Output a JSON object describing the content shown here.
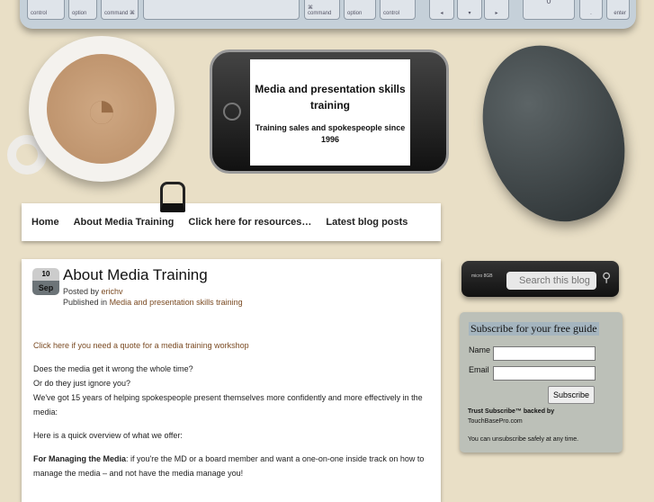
{
  "keyboard": {
    "keys": [
      "control",
      "option",
      "command ⌘",
      "",
      "⌘ command",
      "option",
      "control",
      "◂",
      "▾",
      "▸",
      "0",
      ".",
      "enter"
    ]
  },
  "phone": {
    "title": "Media and presentation skills training",
    "subtitle": "Training sales and spokespeople since 1996"
  },
  "nav": {
    "items": [
      "Home",
      "About Media Training",
      "Click here for resources…",
      "Latest blog posts"
    ]
  },
  "post": {
    "day": "10",
    "month": "Sep",
    "title": "About Media Training",
    "posted_by_label": "Posted by",
    "author": "erichv",
    "published_label": "Published in",
    "category": "Media and presentation skills training",
    "quote_link": "Click here if you need a quote for a media training workshop",
    "p1": [
      "Does the media get it wrong the whole time?",
      "Or do they just ignore you?",
      "We've got 15 years of helping spokespeople present themselves more confidently and more effectively in the media:"
    ],
    "p2": "Here is a quick overview of what we offer:",
    "p3_bold": "For Managing the Media",
    "p3": ": if you're the MD or a board member and want a one-on-one inside track on how to manage the media – and not have the media manage you!"
  },
  "search": {
    "placeholder": "Search this blog",
    "usb_label": "micro 8GB"
  },
  "subscribe": {
    "title": "Subscribe for your free guide",
    "name_label": "Name",
    "email_label": "Email",
    "button": "Subscribe",
    "trust": "Trust Subscribe™ backed by",
    "trust2": "TouchBasePro.com",
    "note": "You can unsubscribe safely at any time."
  }
}
